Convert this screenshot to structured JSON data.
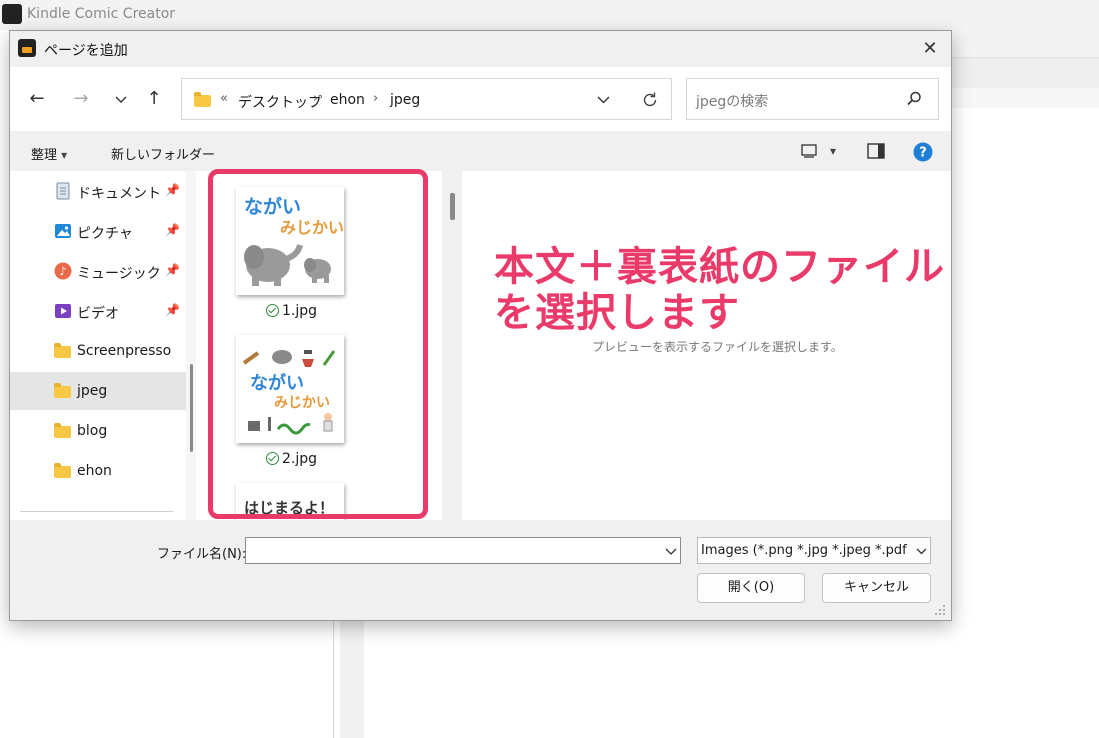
{
  "app": {
    "title": "Kindle Comic Creator"
  },
  "dialog": {
    "title": "ページを追加",
    "close_glyph": "✕",
    "address": {
      "overflow": "«",
      "crumbs": [
        "デスクトップ",
        "ehon",
        "jpeg"
      ]
    },
    "search_placeholder": "jpegの検索",
    "toolbar": {
      "organize": "整理",
      "new_folder": "新しいフォルダー"
    },
    "nav_items": [
      {
        "label": "ドキュメント",
        "pinned": true
      },
      {
        "label": "ピクチャ",
        "pinned": true
      },
      {
        "label": "ミュージック",
        "pinned": true
      },
      {
        "label": "ビデオ",
        "pinned": true
      },
      {
        "label": "Screenpresso",
        "pinned": false
      },
      {
        "label": "jpeg",
        "pinned": false,
        "selected": true
      },
      {
        "label": "blog",
        "pinned": false
      },
      {
        "label": "ehon",
        "pinned": false
      }
    ],
    "files": [
      {
        "name": "1.jpg",
        "thumb_lines": [
          "ながい",
          "みじかい"
        ]
      },
      {
        "name": "2.jpg",
        "thumb_lines": [
          "ながい",
          "みじかい"
        ]
      },
      {
        "name": "",
        "thumb_lines": [
          "はじまるよ！"
        ]
      }
    ],
    "preview_message": "プレビューを表示するファイルを選択します。",
    "file_name_label": "ファイル名(N):",
    "file_name_value": "",
    "file_type": "Images (*.png *.jpg *.jpeg *.pdf",
    "open_button": "開く(O)",
    "cancel_button": "キャンセル"
  },
  "annotation": {
    "line1": "本文＋裏表紙のファイル",
    "line2": "を選択します"
  },
  "colors": {
    "annotation": "#ea3a6a",
    "folder": "#f8c843"
  }
}
